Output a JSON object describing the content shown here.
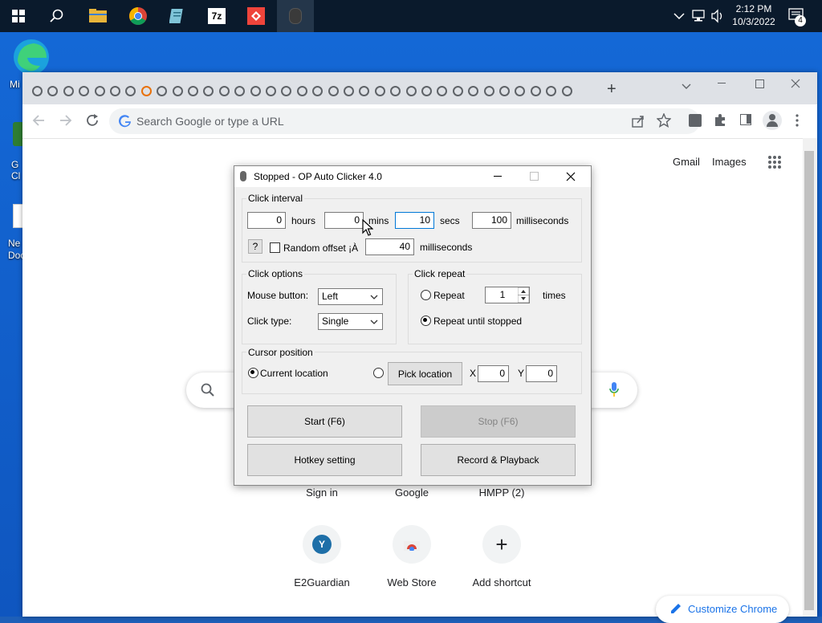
{
  "taskbar": {
    "time": "2:12 PM",
    "date": "10/3/2022",
    "notification_count": "4",
    "icons": [
      "start-icon",
      "search-icon",
      "file-explorer-icon",
      "chrome-icon",
      "notepad-icon",
      "7zip-icon",
      "anydesk-icon",
      "auto-clicker-icon"
    ]
  },
  "desktop": {
    "icons": [
      {
        "label": "Mi"
      },
      {
        "label": "G\nCl"
      },
      {
        "label": "Ne\nDoc"
      }
    ]
  },
  "browser": {
    "new_tab_symbol": "+",
    "omnibox_placeholder": "Search Google or type a URL",
    "header_links": {
      "gmail": "Gmail",
      "images": "Images"
    },
    "shortcuts_row1": [
      "Sign in",
      "Google",
      "HMPP (2)"
    ],
    "shortcuts_row2": [
      {
        "label": "E2Guardian",
        "icon_text": "Y"
      },
      {
        "label": "Web Store",
        "icon_text": ""
      },
      {
        "label": "Add shortcut",
        "icon_text": "+"
      }
    ],
    "customize_label": "Customize Chrome"
  },
  "dialog": {
    "title": "Stopped - OP Auto Clicker 4.0",
    "click_interval": {
      "title": "Click interval",
      "hours_value": "0",
      "hours_label": "hours",
      "mins_value": "0",
      "mins_label": "mins",
      "secs_value": "10",
      "secs_label": "secs",
      "ms_value": "100",
      "ms_label": "milliseconds",
      "help_label": "?",
      "random_offset_label": "Random offset ¡À",
      "random_offset_checked": false,
      "offset_value": "40",
      "offset_label": "milliseconds"
    },
    "click_options": {
      "title": "Click options",
      "mouse_button_label": "Mouse button:",
      "mouse_button_value": "Left",
      "click_type_label": "Click type:",
      "click_type_value": "Single"
    },
    "click_repeat": {
      "title": "Click repeat",
      "repeat_label": "Repeat",
      "repeat_value": "1",
      "times_label": "times",
      "until_stopped_label": "Repeat until stopped",
      "selected": "until_stopped"
    },
    "cursor_position": {
      "title": "Cursor position",
      "current_label": "Current location",
      "pick_label": "Pick location",
      "x_label": "X",
      "x_value": "0",
      "y_label": "Y",
      "y_value": "0",
      "selected": "current"
    },
    "buttons": {
      "start": "Start (F6)",
      "stop": "Stop (F6)",
      "hotkey": "Hotkey setting",
      "record": "Record & Playback"
    }
  }
}
